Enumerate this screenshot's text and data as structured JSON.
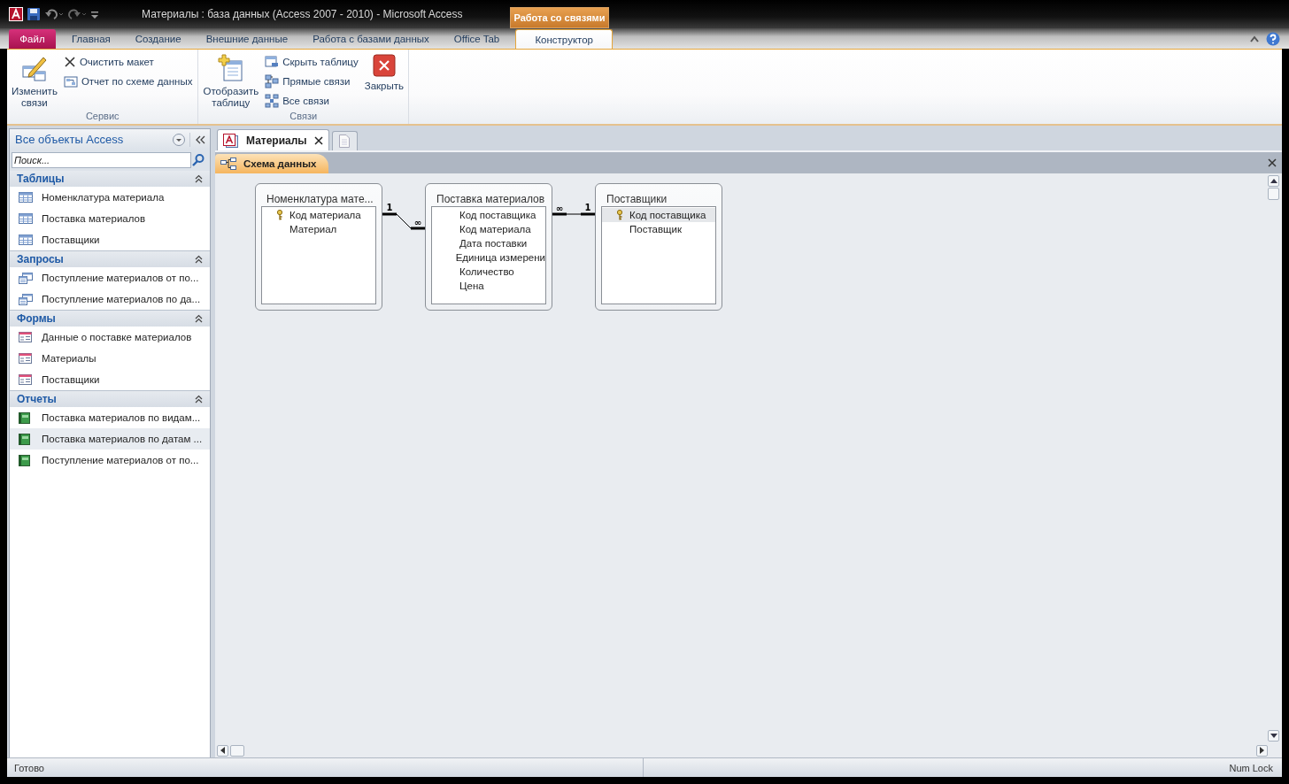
{
  "window": {
    "title": "Материалы : база данных (Access 2007 - 2010)  -  Microsoft Access",
    "context_group": "Работа со связями"
  },
  "ribbon_tabs": [
    {
      "label": "Файл",
      "kind": "file",
      "selected": false
    },
    {
      "label": "Главная",
      "kind": "normal",
      "selected": false
    },
    {
      "label": "Создание",
      "kind": "normal",
      "selected": false
    },
    {
      "label": "Внешние данные",
      "kind": "normal",
      "selected": false
    },
    {
      "label": "Работа с базами данных",
      "kind": "normal",
      "selected": false
    },
    {
      "label": "Office Tab",
      "kind": "normal",
      "selected": false
    },
    {
      "label": "Конструктор",
      "kind": "context",
      "selected": true
    }
  ],
  "ribbon_groups": [
    {
      "label": "Сервис",
      "buttons": [
        {
          "label": "Изменить\nсвязи",
          "kind": "large"
        },
        {
          "label": "Очистить макет",
          "kind": "small"
        },
        {
          "label": "Отчет по схеме данных",
          "kind": "small"
        }
      ]
    },
    {
      "label": "Связи",
      "buttons": [
        {
          "label": "Отобразить\nтаблицу",
          "kind": "large"
        },
        {
          "label": "Скрыть таблицу",
          "kind": "small"
        },
        {
          "label": "Прямые связи",
          "kind": "small"
        },
        {
          "label": "Все связи",
          "kind": "small"
        },
        {
          "label": "Закрыть",
          "kind": "large"
        }
      ]
    }
  ],
  "nav_pane": {
    "title": "Все объекты Access",
    "search": {
      "placeholder": "Поиск..."
    },
    "groups": [
      {
        "label": "Таблицы",
        "kind": "table",
        "expanded": true,
        "items": [
          {
            "name": "Номенклатура материала",
            "selected": false
          },
          {
            "name": "Поставка материалов",
            "selected": false
          },
          {
            "name": "Поставщики",
            "selected": false
          }
        ]
      },
      {
        "label": "Запросы",
        "kind": "query",
        "expanded": true,
        "items": [
          {
            "name": "Поступление материалов от по...",
            "selected": false
          },
          {
            "name": "Поступление материалов по да...",
            "selected": false
          }
        ]
      },
      {
        "label": "Формы",
        "kind": "form",
        "expanded": true,
        "items": [
          {
            "name": "Данные о поставке материалов",
            "selected": false
          },
          {
            "name": "Материалы",
            "selected": false
          },
          {
            "name": "Поставщики",
            "selected": false
          }
        ]
      },
      {
        "label": "Отчеты",
        "kind": "report",
        "expanded": true,
        "items": [
          {
            "name": "Поставка материалов по видам...",
            "selected": false
          },
          {
            "name": "Поставка материалов по датам ...",
            "selected": true
          },
          {
            "name": "Поступление материалов от по...",
            "selected": false
          }
        ]
      }
    ]
  },
  "document_tabs": [
    {
      "label": "Материалы",
      "selected": true
    }
  ],
  "object_tab": {
    "label": "Схема данных"
  },
  "diagram": {
    "tables": [
      {
        "name": "Номенклатура мате...",
        "fields": [
          {
            "name": "Код материала",
            "key": true,
            "selected": false
          },
          {
            "name": "Материал",
            "key": false,
            "selected": false
          }
        ]
      },
      {
        "name": "Поставка материалов",
        "fields": [
          {
            "name": "Код поставщика",
            "key": false,
            "selected": false
          },
          {
            "name": "Код материала",
            "key": false,
            "selected": false
          },
          {
            "name": "Дата поставки",
            "key": false,
            "selected": false
          },
          {
            "name": "Единица измерени",
            "key": false,
            "selected": false
          },
          {
            "name": "Количество",
            "key": false,
            "selected": false
          },
          {
            "name": "Цена",
            "key": false,
            "selected": false
          }
        ]
      },
      {
        "name": "Поставщики",
        "fields": [
          {
            "name": "Код поставщика",
            "key": true,
            "selected": true
          },
          {
            "name": "Поставщик",
            "key": false,
            "selected": false
          }
        ]
      }
    ],
    "relationships": [
      {
        "one_label": "1",
        "many_label": "∞"
      },
      {
        "one_label": "1",
        "many_label": "∞"
      }
    ]
  },
  "status_bar": {
    "left": "Готово",
    "right": "Num Lock"
  }
}
